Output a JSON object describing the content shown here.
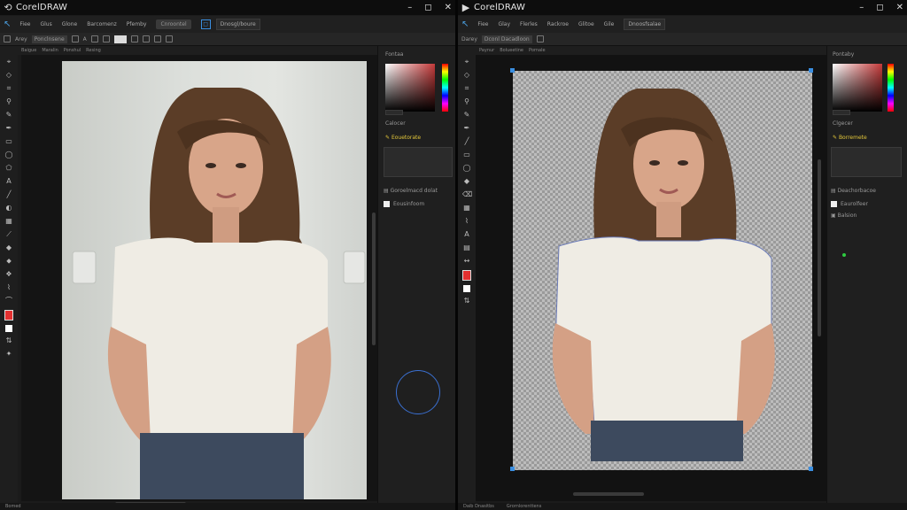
{
  "left": {
    "title": "CorelDRAW",
    "menu": [
      "Fiee",
      "Glus",
      "Glone",
      "Barcomenz",
      "Pfemby"
    ],
    "menu_chip": "Cnroontel",
    "menu_dropdown": "Dnosgl/boure",
    "propbar": [
      "Arey",
      "Ponclnsene"
    ],
    "tabs": [
      "Baigue",
      "Maralin",
      "Ponshul",
      "Resing"
    ],
    "panel": {
      "header": "Fontaa",
      "section1": "Calocer",
      "item1": "Eouetorate",
      "item2": "Goroelmacd dolat",
      "item3": "Eousinfoom"
    },
    "status": "Bomed"
  },
  "right": {
    "title": "CorelDRAW",
    "menu": [
      "Fiee",
      "Glay",
      "Flerles",
      "Rackroe",
      "Glitoe",
      "Gile"
    ],
    "menu_dropdown": "Dnoosfsalae",
    "propbar": [
      "Darey",
      "Dconl Dacadloon"
    ],
    "tabs": [
      "Paynur",
      "Bolueetine",
      "Pornale"
    ],
    "panel": {
      "header": "Pontaby",
      "section1": "Clgecer",
      "item1": "Borremete",
      "item2": "Deachorbacoe",
      "item3": "Eaurolfeer",
      "item4": "Balsion"
    },
    "status": [
      "Daib Dnasitbs",
      "Grornlorenttens"
    ]
  },
  "colors": {
    "accent": "#3a8ee0",
    "fill_red": "#e23030"
  },
  "icons": [
    "corel-logo-icon",
    "minimize-icon",
    "restore-icon",
    "close-icon",
    "pick-tool-icon",
    "lock-icon"
  ]
}
